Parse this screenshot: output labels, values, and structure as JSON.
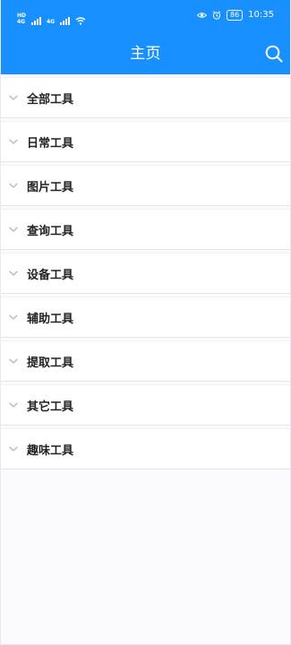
{
  "status_bar": {
    "sim1_top": "HD",
    "sim1_bottom": "4G",
    "sim2_label": "4G",
    "battery": "86",
    "time": "10:35",
    "icons": [
      "sim-icon",
      "signal-icon",
      "wifi-icon",
      "eye-icon",
      "alarm-icon",
      "battery-icon"
    ]
  },
  "header": {
    "title": "主页",
    "search_icon": "search-icon"
  },
  "categories": [
    "全部工具",
    "日常工具",
    "图片工具",
    "查询工具",
    "设备工具",
    "辅助工具",
    "提取工具",
    "其它工具",
    "趣味工具"
  ],
  "colors": {
    "primary": "#1890ff",
    "background": "#fbfbfd",
    "chevron": "#b5b9c2"
  }
}
